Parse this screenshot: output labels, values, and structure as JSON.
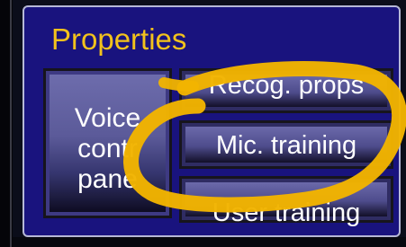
{
  "panel": {
    "title": "Properties",
    "buttons": {
      "voice_control_panel": {
        "lines": [
          "Voice",
          "contr",
          "pane"
        ]
      },
      "recog_props": "Recog. props",
      "mic_training": "Mic. training",
      "user_training": "User training"
    }
  },
  "annotation": {
    "color": "#f2b400",
    "shape": "hand-drawn ellipse"
  }
}
